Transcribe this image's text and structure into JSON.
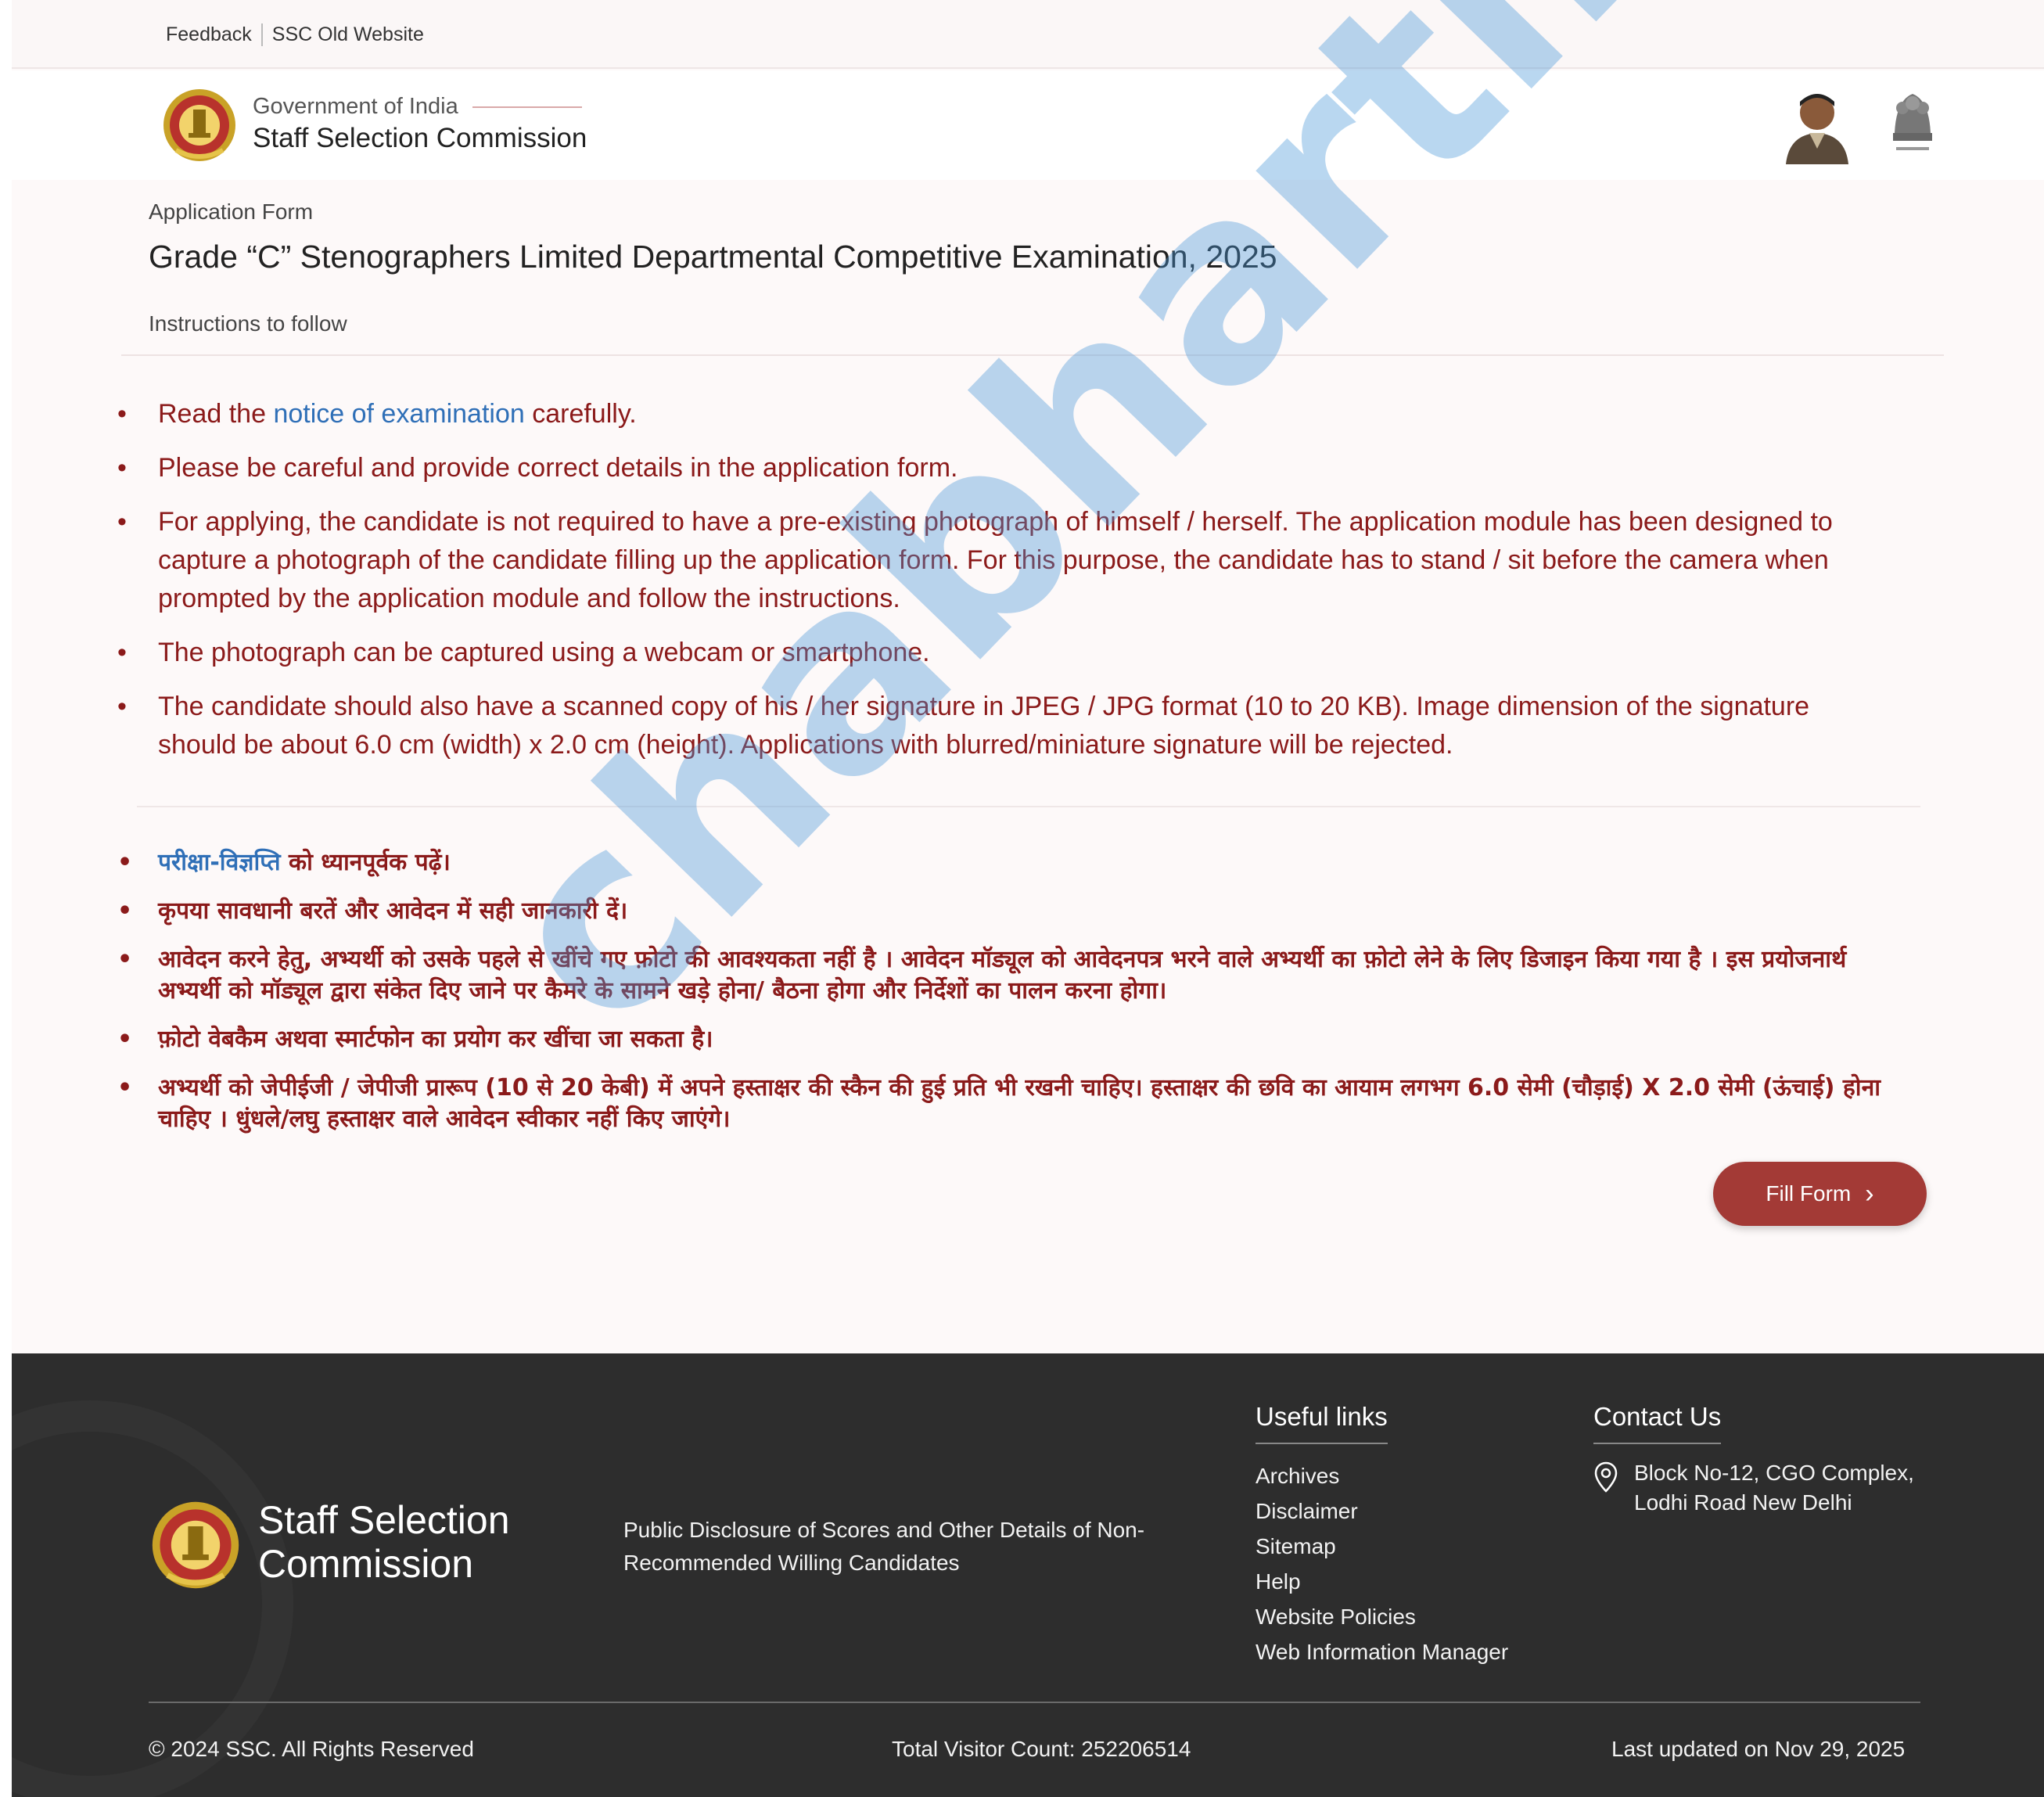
{
  "topbar": {
    "links": [
      "Feedback",
      "SSC Old Website"
    ]
  },
  "header": {
    "gov_label": "Government of India",
    "org_name": "Staff Selection Commission"
  },
  "form": {
    "section_label": "Application Form",
    "title": "Grade “C” Stenographers Limited Departmental Competitive Examination, 2025",
    "instructions_label": "Instructions to follow"
  },
  "instructions_en": {
    "item1_pre": "Read the ",
    "item1_link": "notice of examination",
    "item1_post": " carefully.",
    "item2": "Please be careful and provide correct details in the application form.",
    "item3": "For applying, the candidate is not required to have a pre-existing photograph of himself / herself. The application module has been designed to capture a photograph of the candidate filling up the application form. For this purpose, the candidate has to stand / sit before the camera when prompted by the application module and follow the instructions.",
    "item4": "The photograph can be captured using a webcam or smartphone.",
    "item5": "The candidate should also have a scanned copy of his / her signature in JPEG / JPG format (10 to 20 KB). Image dimension of the signature should be about 6.0 cm (width) x 2.0 cm (height). Applications with blurred/miniature signature will be rejected."
  },
  "instructions_hi": {
    "item1_link": "परीक्षा-विज्ञप्ति",
    "item1_post": " को ध्यानपूर्वक पढ़ें।",
    "item2": "कृपया सावधानी बरतें और आवेदन में सही जानकारी दें।",
    "item3": "आवेदन करने हेतु, अभ्यर्थी को उसके पहले से खींचे गए फ़ोटो की आवश्यकता नहीं है । आवेदन मॉड्यूल को आवेदनपत्र भरने वाले अभ्यर्थी का फ़ोटो लेने के लिए डिजाइन किया गया है । इस प्रयोजनार्थ अभ्यर्थी को मॉड्यूल द्वारा संकेत दिए जाने पर कैमरे के सामने खड़े होना/ बैठना होगा और निर्देशों का पालन करना होगा।",
    "item4": "फ़ोटो वेबकैम अथवा स्मार्टफोन का प्रयोग कर खींचा जा सकता है।",
    "item5": "अभ्यर्थी को जेपीईजी / जेपीजी प्रारूप (10 से 20 केबी) में अपने हस्ताक्षर की स्कैन की हुई प्रति भी रखनी चाहिए। हस्ताक्षर की छवि का आयाम लगभग 6.0 सेमी (चौड़ाई) X 2.0 सेमी (ऊंचाई) होना चाहिए । धुंधले/लघु हस्ताक्षर वाले आवेदन स्वीकार नहीं किए जाएंगे।"
  },
  "fill_button": {
    "label": "Fill Form"
  },
  "footer": {
    "brand_line1": "Staff Selection",
    "brand_line2": "Commission",
    "disclosure": "Public Disclosure of Scores and Other Details of Non-Recommended Willing Candidates",
    "useful_links_heading": "Useful links",
    "useful_links": [
      "Archives",
      "Disclaimer",
      "Sitemap",
      "Help",
      "Website Policies",
      "Web Information Manager"
    ],
    "contact_heading": "Contact Us",
    "address_line1": "Block No-12, CGO Complex,",
    "address_line2": "Lodhi Road New Delhi",
    "copyright": "© 2024 SSC. All Rights Reserved",
    "visitor_count": "Total Visitor Count: 252206514",
    "last_updated": "Last updated on Nov 29, 2025"
  },
  "watermark": "chabharti.in",
  "colors": {
    "accent": "#a33a36",
    "instruction_text": "#8b1a1a",
    "link": "#2f6fb7",
    "footer_bg": "#2d2d2d"
  }
}
